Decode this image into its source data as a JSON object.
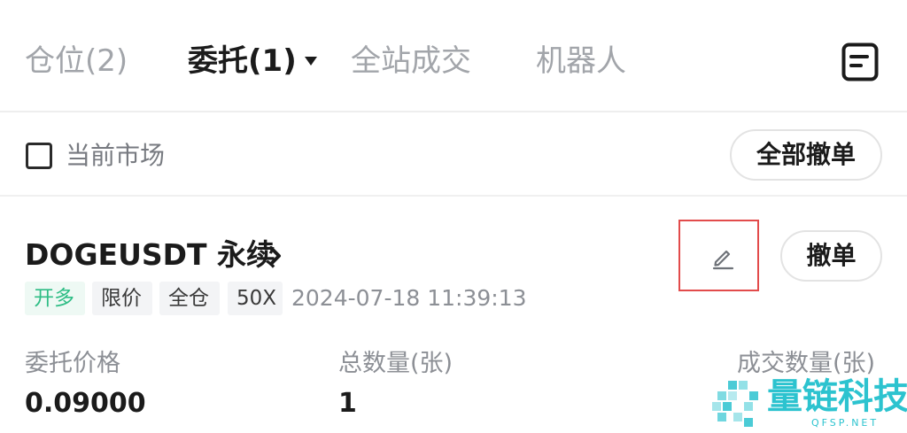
{
  "tabs": [
    {
      "label": "仓位(2)",
      "active": false
    },
    {
      "label": "委托(1)",
      "active": true
    },
    {
      "label": "全站成交",
      "active": false
    },
    {
      "label": "机器人",
      "active": false
    }
  ],
  "header_icon": "document-list-icon",
  "filter": {
    "label": "当前市场",
    "checked": false,
    "cancel_all_label": "全部撤单"
  },
  "order": {
    "symbol": "DOGEUSDT 永续",
    "tags": [
      "开多",
      "限价",
      "全仓",
      "50X"
    ],
    "timestamp": "2024-07-18 11:39:13",
    "edit_icon": "pencil-edit-icon",
    "cancel_label": "撤单",
    "fields": [
      {
        "label": "委托价格",
        "value": "0.09000"
      },
      {
        "label": "总数量(张)",
        "value": "1"
      },
      {
        "label": "成交数量(张)",
        "value": ""
      }
    ]
  },
  "colors": {
    "long_green": "#2ebd85",
    "highlight_red": "#e24b4b",
    "watermark_teal": "#2cc3cf"
  },
  "watermark": {
    "text": "量链科技",
    "sub": "QFSP.NET"
  }
}
